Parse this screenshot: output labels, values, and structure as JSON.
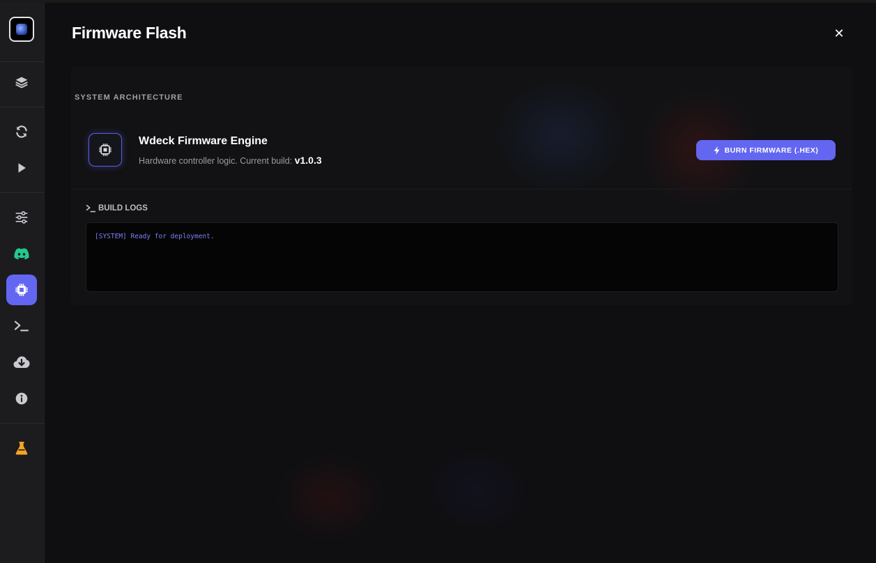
{
  "app": {
    "title": "Firmware Flash",
    "close_label": "✕"
  },
  "sidebar": {
    "items": [
      {
        "name": "layers",
        "icon": "layers-icon",
        "active": false
      },
      {
        "name": "sync",
        "icon": "sync-icon",
        "active": false
      },
      {
        "name": "play",
        "icon": "play-icon",
        "active": false
      },
      {
        "name": "settings",
        "icon": "sliders-icon",
        "active": false
      },
      {
        "name": "discord",
        "icon": "discord-icon",
        "active": false
      },
      {
        "name": "firmware",
        "icon": "chip-icon",
        "active": true
      },
      {
        "name": "terminal",
        "icon": "terminal-icon",
        "active": false
      },
      {
        "name": "download",
        "icon": "cloud-download-icon",
        "active": false
      },
      {
        "name": "info",
        "icon": "info-icon",
        "active": false
      },
      {
        "name": "labs",
        "icon": "flask-icon",
        "active": false
      }
    ]
  },
  "section": {
    "label": "SYSTEM ARCHITECTURE"
  },
  "engine": {
    "title": "Wdeck Firmware Engine",
    "description": "Hardware controller logic. Current build: ",
    "version": "v1.0.3",
    "burn_label": "BURN FIRMWARE (.HEX)"
  },
  "logs": {
    "label": "BUILD LOGS",
    "lines": [
      "[SYSTEM] Ready for deployment."
    ]
  },
  "colors": {
    "accent": "#6366f1",
    "discord": "#22c98d",
    "flask": "#f5a524",
    "log_text": "#7c7ff5"
  }
}
